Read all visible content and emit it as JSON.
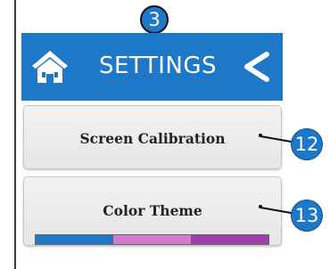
{
  "header": {
    "title": "SETTINGS",
    "background_color": "#1e78c8",
    "home_icon": "home-icon",
    "back_icon": "back-chevron-icon"
  },
  "buttons": [
    {
      "label": "Screen Calibration"
    },
    {
      "label": "Color Theme"
    }
  ],
  "color_theme": {
    "swatches": [
      "#1e78c8",
      "#d37ad0",
      "#a13ea8"
    ]
  },
  "callouts": {
    "header": "3",
    "screen_calibration": "12",
    "color_theme": "13"
  }
}
